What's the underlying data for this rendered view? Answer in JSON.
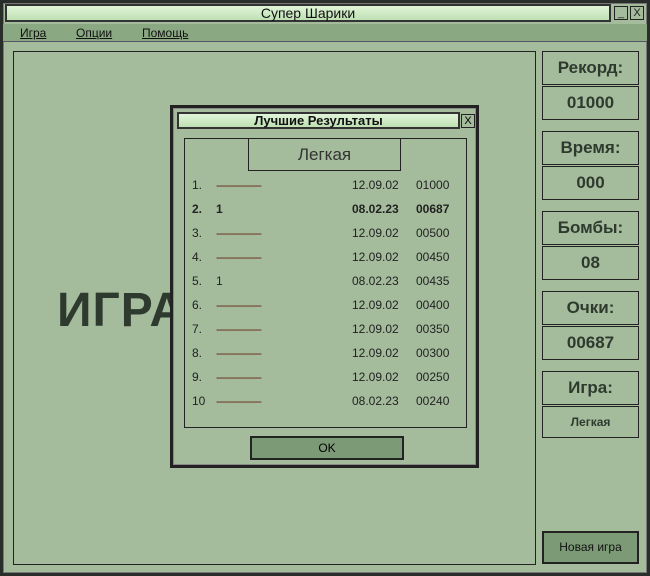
{
  "window": {
    "title": "Супер Шарики",
    "minimize": "_",
    "close": "X"
  },
  "menu": [
    "Игра",
    "Опции",
    "Помощь"
  ],
  "game": {
    "overlay_text": "ИГРА ОКОНЧЕНА"
  },
  "stats": [
    {
      "label": "Рекорд:",
      "value": "01000"
    },
    {
      "label": "Время:",
      "value": "000"
    },
    {
      "label": "Бомбы:",
      "value": "08"
    },
    {
      "label": "Очки:",
      "value": "00687"
    },
    {
      "label": "Игра:",
      "value": "Легкая"
    }
  ],
  "new_game": "Новая игра",
  "dialog": {
    "title": "Лучшие Результаты",
    "close": "X",
    "tab": "Легкая",
    "ok": "OK",
    "rows": [
      {
        "rank": "1.",
        "name": "---------------",
        "date": "12.09.02",
        "score": "01000"
      },
      {
        "rank": "2.",
        "name": "1",
        "date": "08.02.23",
        "score": "00687",
        "highlight": true
      },
      {
        "rank": "3.",
        "name": "---------------",
        "date": "12.09.02",
        "score": "00500"
      },
      {
        "rank": "4.",
        "name": "---------------",
        "date": "12.09.02",
        "score": "00450"
      },
      {
        "rank": "5.",
        "name": "1",
        "date": "08.02.23",
        "score": "00435"
      },
      {
        "rank": "6.",
        "name": "---------------",
        "date": "12.09.02",
        "score": "00400"
      },
      {
        "rank": "7.",
        "name": "---------------",
        "date": "12.09.02",
        "score": "00350"
      },
      {
        "rank": "8.",
        "name": "---------------",
        "date": "12.09.02",
        "score": "00300"
      },
      {
        "rank": "9.",
        "name": "---------------",
        "date": "12.09.02",
        "score": "00250"
      },
      {
        "rank": "10",
        "name": "---------------",
        "date": "08.02.23",
        "score": "00240"
      }
    ]
  },
  "colors": {
    "background": "#a4bc9c",
    "titlebar": "#c8e8c0",
    "menubar": "#8aa882",
    "button": "#7d9a76",
    "dash": "#6a2a1a"
  }
}
